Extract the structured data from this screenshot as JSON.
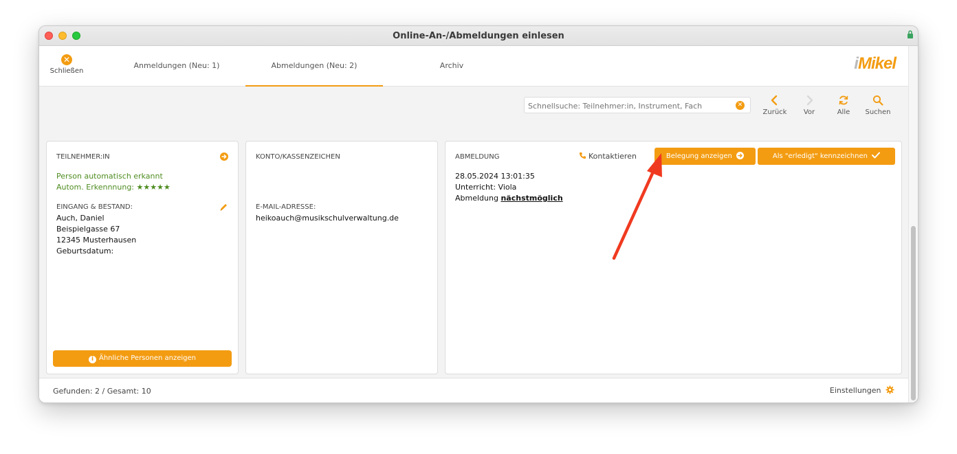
{
  "window": {
    "title": "Online-An-/Abmeldungen einlesen"
  },
  "toolbar": {
    "close_label": "Schließen",
    "tabs": [
      {
        "label": "Anmeldungen (Neu: 1)"
      },
      {
        "label": "Abmeldungen (Neu: 2)",
        "active": true
      },
      {
        "label": "Archiv"
      }
    ],
    "logo": {
      "prefix": "i",
      "rest": "Mikel"
    }
  },
  "search": {
    "placeholder": "Schnellsuche: Teilnehmer:in, Instrument, Fach",
    "buttons": [
      {
        "label": "Zurück",
        "icon": "chevron-left-icon"
      },
      {
        "label": "Vor",
        "icon": "chevron-right-icon"
      },
      {
        "label": "Alle",
        "icon": "refresh-icon"
      },
      {
        "label": "Suchen",
        "icon": "search-icon"
      }
    ]
  },
  "participant": {
    "heading": "TEILNEHMER:IN",
    "status": "Person automatisch erkannt",
    "recognition": "Autom. Erkennnung: ★★★★★",
    "stock_heading": "EINGANG & BESTAND:",
    "address": [
      "Auch, Daniel",
      "Beispielgasse 67",
      "12345 Musterhausen",
      "Geburtsdatum:"
    ],
    "similar_button": "Ähnliche Personen anzeigen"
  },
  "account": {
    "heading": "KONTO/KASSENZEICHEN",
    "email_heading": "E-MAIL-ADRESSE:",
    "email": "heikoauch@musikschulverwaltung.de"
  },
  "cancellation": {
    "heading": "ABMELDUNG",
    "contact_label": "Kontaktieren",
    "show_booking_button": "Belegung anzeigen",
    "mark_done_button": "Als \"erledigt\" kennzeichnen",
    "date": "28.05.2024 13:01:35",
    "lesson": "Unterricht: Viola",
    "notice_prefix": "Abmeldung",
    "notice_value": "nächstmöglich"
  },
  "status": {
    "found": "Gefunden: 2 / Gesamt: 10",
    "settings": "Einstellungen"
  },
  "colors": {
    "accent": "#f39c12",
    "success": "#4e8c20",
    "annotation": "#f03a20"
  }
}
